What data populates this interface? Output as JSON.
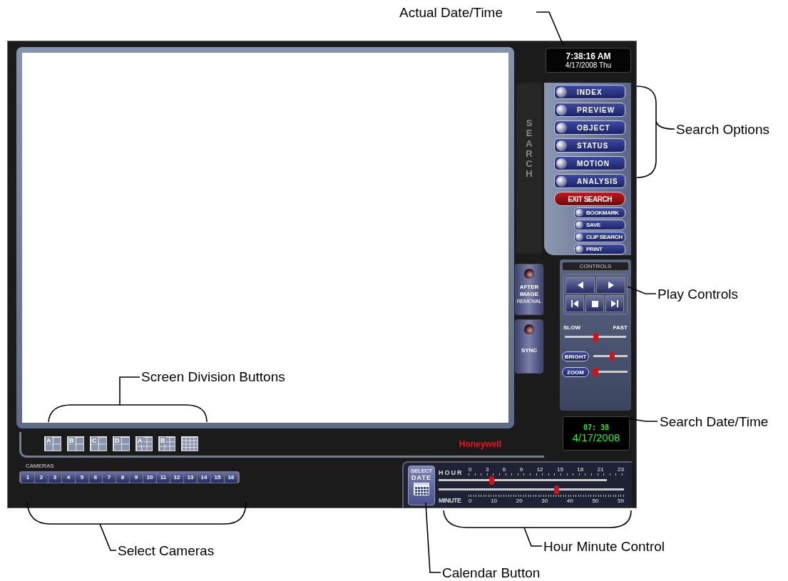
{
  "clock": {
    "time": "7:38:16 AM",
    "date": "4/17/2008 Thu"
  },
  "search_tab": {
    "label": "SEARCH"
  },
  "search_buttons": [
    {
      "label": "INDEX",
      "kind": "option"
    },
    {
      "label": "PREVIEW",
      "kind": "option"
    },
    {
      "label": "OBJECT",
      "kind": "option"
    },
    {
      "label": "STATUS",
      "kind": "option"
    },
    {
      "label": "MOTION",
      "kind": "option"
    },
    {
      "label": "ANALYSIS",
      "kind": "option"
    },
    {
      "label": "EXIT SEARCH",
      "kind": "exit"
    }
  ],
  "small_buttons": [
    "BOOKMARK",
    "SAVE",
    "CLIP SEARCH",
    "PRINT"
  ],
  "side_buttons": [
    {
      "lines": [
        "AFTER",
        "IMAGE",
        "REMOVAL"
      ]
    },
    {
      "lines": [
        "SYNC"
      ]
    }
  ],
  "controls": {
    "title": "CONTROLS",
    "buttons": [
      {
        "kind": "reverse"
      },
      {
        "kind": "play"
      },
      {
        "kind": "prev"
      },
      {
        "kind": "stop"
      },
      {
        "kind": "next"
      }
    ]
  },
  "speed": {
    "slow": "SLOW",
    "fast": "FAST",
    "level": 0.5
  },
  "bright": {
    "label": "BRIGHT",
    "level": 0.55
  },
  "zoom": {
    "label": "ZOOM",
    "level": 0
  },
  "search_time": {
    "time": "07: 38",
    "date": "4/17/2008"
  },
  "division_buttons": [
    {
      "letter": "A",
      "kind": "quad"
    },
    {
      "letter": "B",
      "kind": "quad"
    },
    {
      "letter": "C",
      "kind": "quad"
    },
    {
      "letter": "D",
      "kind": "quad"
    },
    {
      "letter": "A",
      "kind": "nine"
    },
    {
      "letter": "B",
      "kind": "nine"
    },
    {
      "kind": "sixteen"
    }
  ],
  "brand": "Honeywell",
  "cameras": {
    "title": "CAMERAS",
    "buttons": [
      "1",
      "2",
      "3",
      "4",
      "5",
      "6",
      "7",
      "8",
      "9",
      "10",
      "11",
      "12",
      "13",
      "14",
      "15",
      "16"
    ]
  },
  "select_date": {
    "line1": "SELECT",
    "line2": "DATE"
  },
  "hour": {
    "label": "HOUR",
    "ticks": [
      "0",
      "3",
      "6",
      "9",
      "12",
      "15",
      "18",
      "21",
      "23"
    ],
    "level": 0.31
  },
  "minute": {
    "label": "MINUTE",
    "ticks": [
      "0",
      "10",
      "20",
      "30",
      "40",
      "50",
      "59"
    ],
    "level": 0.64
  },
  "callouts": [
    {
      "label": "Actual Date/Time"
    },
    {
      "label": "Search Options"
    },
    {
      "label": "Play Controls"
    },
    {
      "label": "Search Date/Time"
    },
    {
      "label": "Screen Division Buttons"
    },
    {
      "label": "Select Cameras"
    },
    {
      "label": "Hour Minute Control"
    },
    {
      "label": "Calendar Button"
    }
  ]
}
